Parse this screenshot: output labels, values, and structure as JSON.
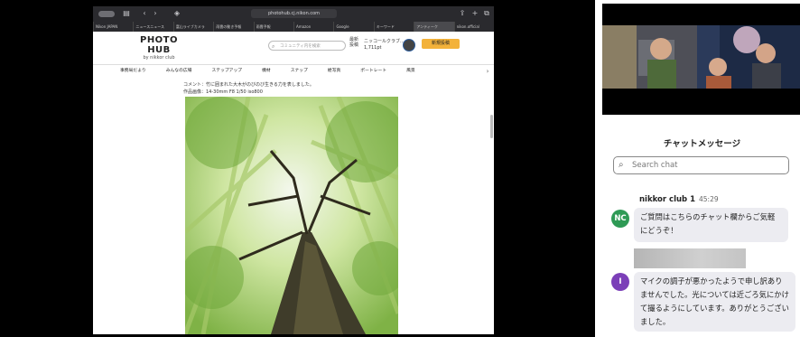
{
  "browser": {
    "url": "photohub.cj.nikon.com",
    "tabs": [
      "Nikon JAPAN",
      "ニュースニュース",
      "富山ライブカメラ",
      "雨雲の動き予報",
      "雨雲予報",
      "Amazon",
      "Google",
      "キーワード",
      "アンティーク",
      "nikon.official"
    ]
  },
  "site": {
    "logo": "PHOTO HUB",
    "logo_sub": "by nikkor club",
    "search_placeholder": "コミュニティ内を検索",
    "account_label": "最新投稿",
    "user_name": "ニッコールクラブ...",
    "user_points": "1,711pt",
    "post_button": "新規投稿",
    "nav": [
      "事務局だより",
      "みんなの広場",
      "ステップアップ",
      "機材",
      "スナップ",
      "絵写真",
      "ポートレート",
      "風景"
    ],
    "caption_line1": "コメント：竹に囲まれた大木がのびのび生きる力を表しました。",
    "caption_line2": "作品画像：14-30mm F8 1/50 iso800"
  },
  "chat": {
    "title": "チャットメッセージ",
    "search_placeholder": "Search chat",
    "messages": [
      {
        "sender": "nikkor club 1",
        "time": "45:29",
        "initials": "NC",
        "text": "ご質問はこちらのチャット欄からご気軽にどうぞ！"
      },
      {
        "sender": "",
        "time": "",
        "initials": "I",
        "text": "マイクの調子が悪かったようで申し訳ありませんでした。光については近ごろ気にかけて撮るようにしています。ありがとうございました。"
      }
    ]
  },
  "colors": {
    "accent": "#f3b23a",
    "nc_avatar": "#2e9a55",
    "i_avatar": "#7b3fb8"
  }
}
